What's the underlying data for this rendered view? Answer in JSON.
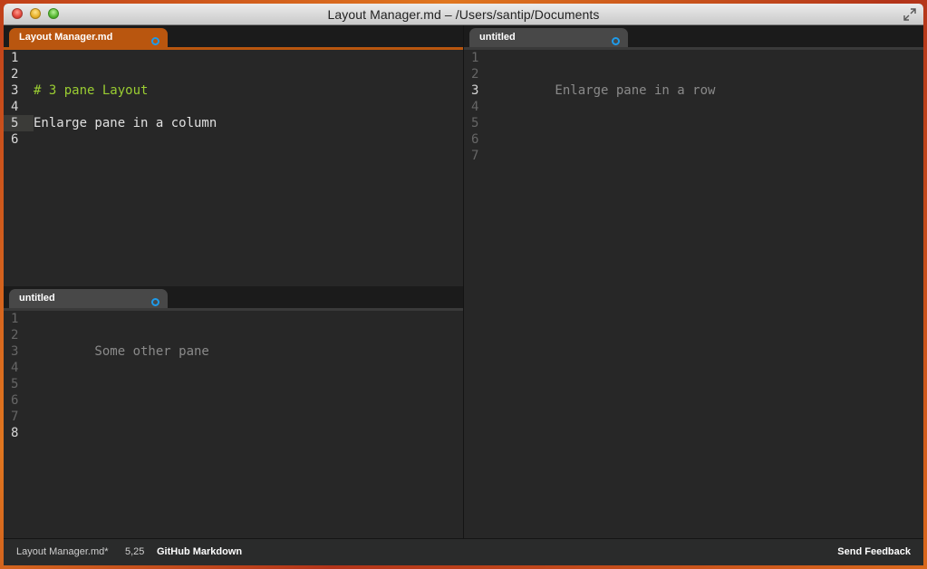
{
  "window": {
    "title": "Layout Manager.md – /Users/santip/Documents"
  },
  "panes": {
    "top_left": {
      "tab_label": "Layout Manager.md",
      "active": true,
      "gutter": [
        "1",
        "2",
        "3",
        "4",
        "5",
        "6"
      ],
      "lines": [
        "",
        "",
        "# 3 pane Layout",
        "",
        "Enlarge pane in a column",
        ""
      ]
    },
    "right": {
      "tab_label": "untitled",
      "active": false,
      "gutter": [
        "1",
        "2",
        "3",
        "4",
        "5",
        "6",
        "7"
      ],
      "lines": [
        "",
        "",
        "        Enlarge pane in a row",
        "",
        "",
        "",
        ""
      ]
    },
    "bottom_left": {
      "tab_label": "untitled",
      "active": false,
      "gutter": [
        "1",
        "2",
        "3",
        "4",
        "5",
        "6",
        "7",
        "8"
      ],
      "lines": [
        "",
        "",
        "        Some other pane",
        "",
        "",
        "",
        "",
        ""
      ]
    }
  },
  "statusbar": {
    "file": "Layout Manager.md*",
    "cursor": "5,25",
    "syntax": "GitHub Markdown",
    "feedback": "Send Feedback"
  },
  "colors": {
    "accent_tab": "#b9560f",
    "unsaved_dot": "#1e9bea",
    "heading_text": "#9acd32"
  },
  "icons": {
    "fullscreen": "fullscreen-icon",
    "unsaved": "unsaved-dot-icon"
  }
}
